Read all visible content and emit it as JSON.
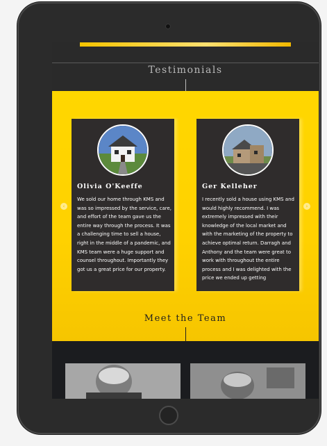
{
  "testimonials": {
    "heading": "Testimonials",
    "prev_icon": "chevron-left-icon",
    "next_icon": "chevron-right-icon",
    "items": [
      {
        "name": "Olivia O'Keeffe",
        "quote": "We sold our home through KMS and was so impressed by the service, care, and effort of the team gave us the entire way through the process. It was a challenging time to sell a house, right in the middle of a pandemic, and KMS team were a huge support and counsel throughout. Importantly they got us a great price for our property."
      },
      {
        "name": "Ger Kelleher",
        "quote": "I recently sold a house using KMS and would highly recommend. I was extremely impressed with their knowledge of the local market and with the marketing of the property to achieve optimal return. Darragh and Anthony and the team were great to work with throughout the entire process and I was delighted with the price we ended up getting"
      }
    ]
  },
  "team": {
    "heading": "Meet the Team"
  },
  "colors": {
    "accent": "#ffd700",
    "card": "#2f2c2c",
    "dark": "#1c1c1c"
  }
}
